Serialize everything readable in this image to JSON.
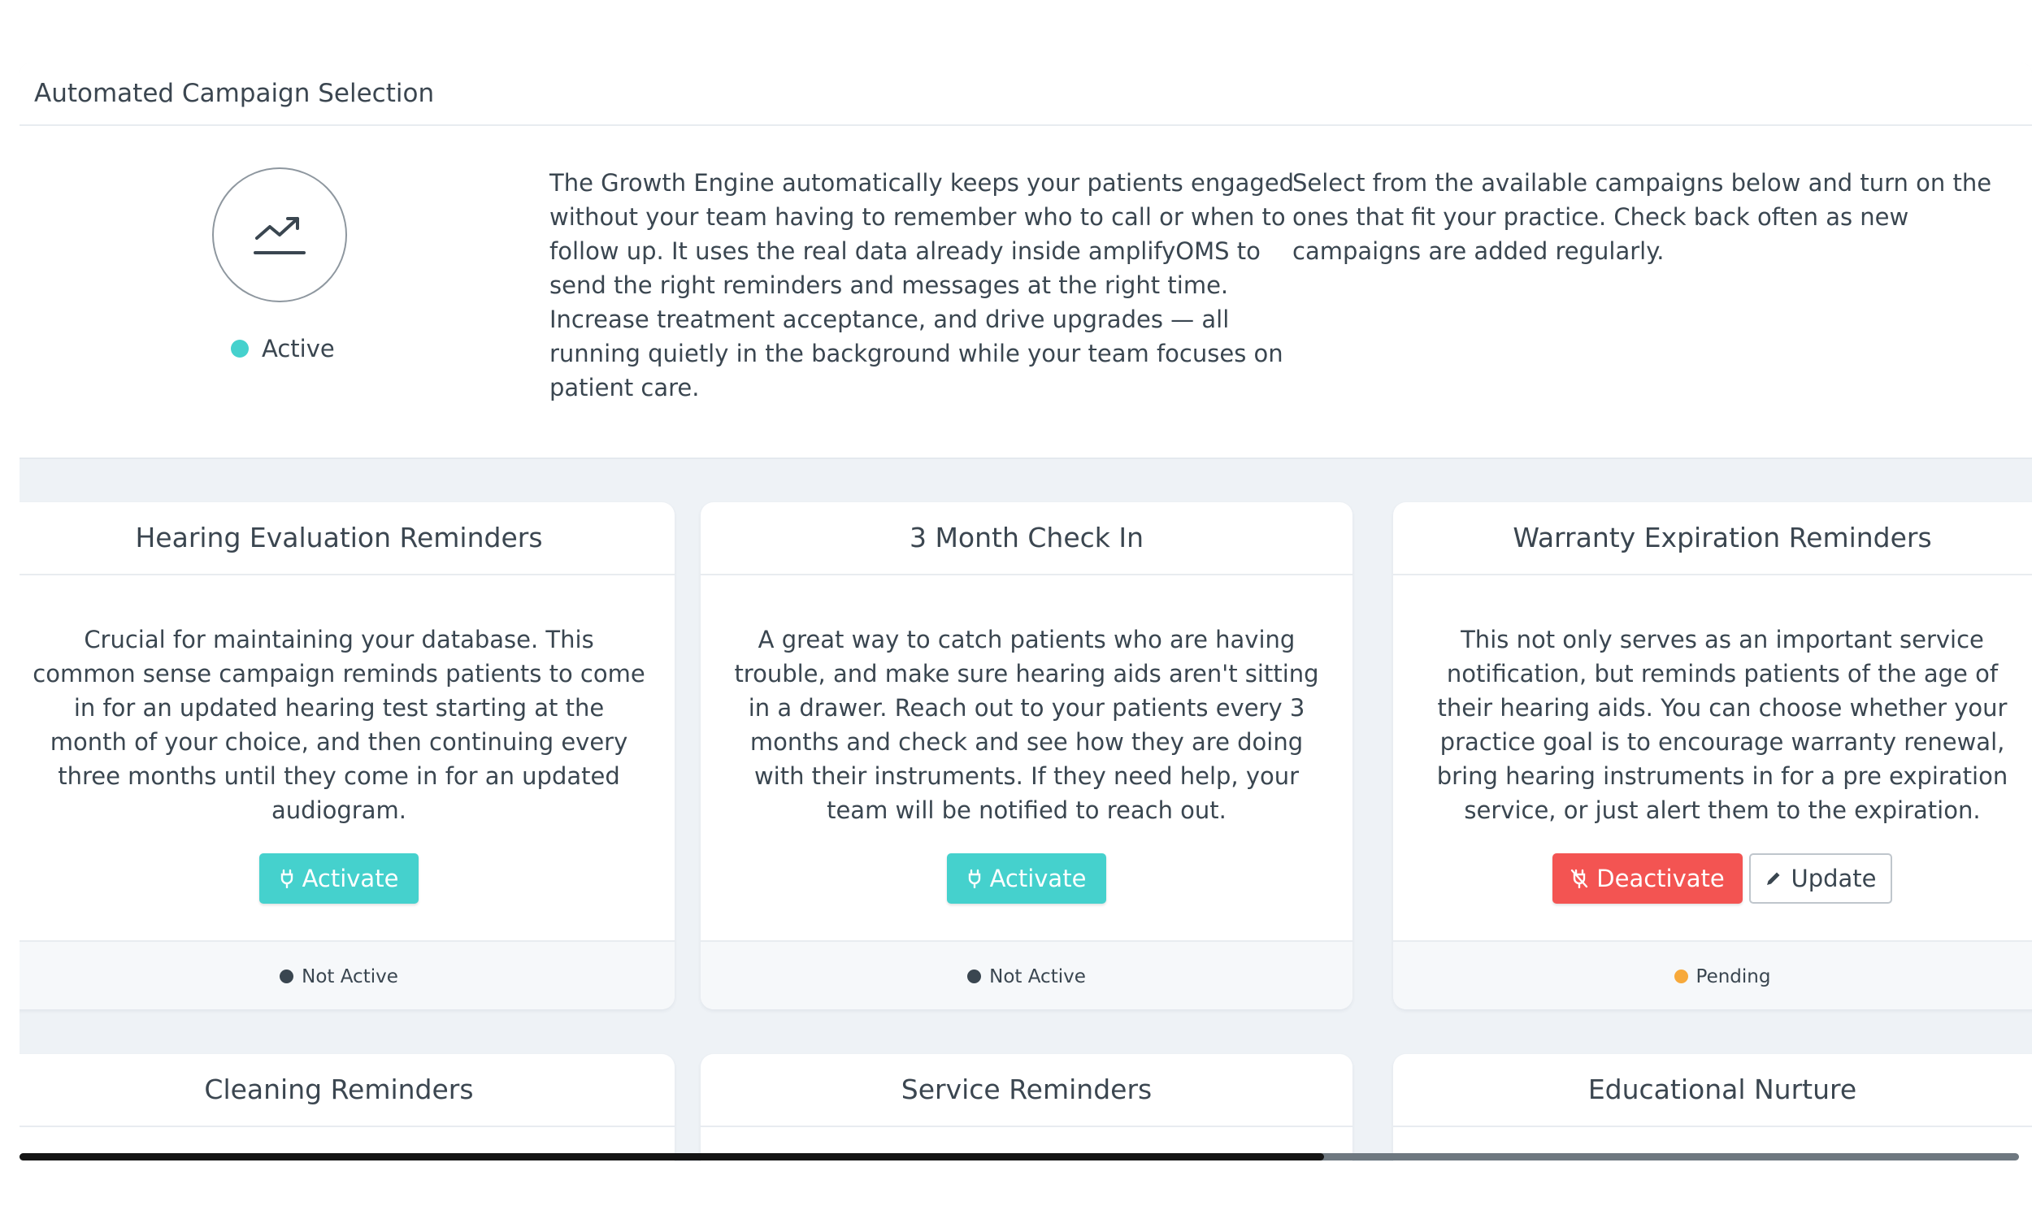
{
  "header": {
    "title": "Automated Campaign Selection",
    "engine_icon": "trend-up-icon",
    "status": {
      "label": "Active",
      "color": "#45d1cd"
    },
    "description": "The Growth Engine automatically keeps your patients engaged without your team having to remember who to call or when to follow up. It uses the real data already inside amplifyOMS to send the right reminders and messages at the right time. Increase treatment acceptance, and drive upgrades — all running quietly in the background while your team focuses on patient care.",
    "instructions": "Select from the available campaigns below and turn on the ones that fit your practice. Check back often as new campaigns are added regularly."
  },
  "colors": {
    "accent": "#45d1cd",
    "danger": "#f35452",
    "pending": "#f7a93b",
    "inactive": "#3a4650"
  },
  "campaigns": [
    {
      "title": "Hearing Evaluation Reminders",
      "description": "Crucial for maintaining your database. This common sense campaign reminds patients to come in for an updated hearing test starting at the month of your choice, and then continuing every three months until they come in for an updated audiogram.",
      "activate_label": "Activate",
      "activate_icon": "plug-icon",
      "status_label": "Not Active"
    },
    {
      "title": "3 Month Check In",
      "description": "A great way to catch patients who are having trouble, and make sure hearing aids aren't sitting in a drawer. Reach out to your patients every 3 months and check and see how they are doing with their instruments. If they need help, your team will be notified to reach out.",
      "activate_label": "Activate",
      "activate_icon": "plug-icon",
      "status_label": "Not Active"
    },
    {
      "title": "Warranty Expiration Reminders",
      "description": "This not only serves as an important service notification, but reminds patients of the age of their hearing aids. You can choose whether your practice goal is to encourage warranty renewal, bring hearing instruments in for a pre expiration service, or just alert them to the expiration.",
      "deactivate_label": "Deactivate",
      "deactivate_icon": "unplug-icon",
      "update_label": "Update",
      "update_icon": "pencil-icon",
      "status_label": "Pending"
    },
    {
      "title": "Cleaning Reminders"
    },
    {
      "title": "Service Reminders"
    },
    {
      "title": "Educational Nurture"
    }
  ]
}
